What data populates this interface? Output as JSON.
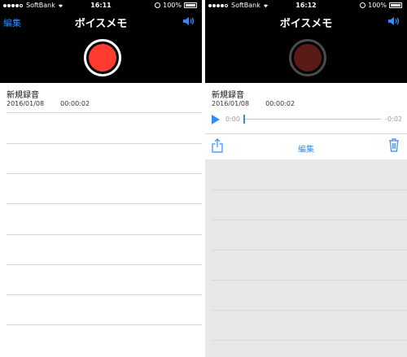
{
  "left": {
    "status": {
      "carrier": "SoftBank",
      "time": "16:11",
      "battery": "100%"
    },
    "title": "ボイスメモ",
    "edit_label": "編集",
    "recording": {
      "name": "新規録音",
      "date": "2016/01/08",
      "duration": "00:00:02"
    }
  },
  "right": {
    "status": {
      "carrier": "SoftBank",
      "time": "16:12",
      "battery": "100%"
    },
    "title": "ボイスメモ",
    "recording": {
      "name": "新規録音",
      "date": "2016/01/08",
      "duration": "00:00:02"
    },
    "player": {
      "position": "0:00",
      "remaining": "-0:02"
    },
    "toolbar": {
      "edit_label": "編集"
    }
  },
  "colors": {
    "accent": "#2f8cff",
    "record": "#ff3b30",
    "record_dim": "#5a1a15",
    "header": "#000000",
    "gray_area": "#e8e8e8"
  },
  "icons": [
    "wifi-icon",
    "lock-rotation-icon",
    "battery-icon",
    "speaker-icon",
    "record-button",
    "play-icon",
    "share-icon",
    "trash-icon"
  ]
}
